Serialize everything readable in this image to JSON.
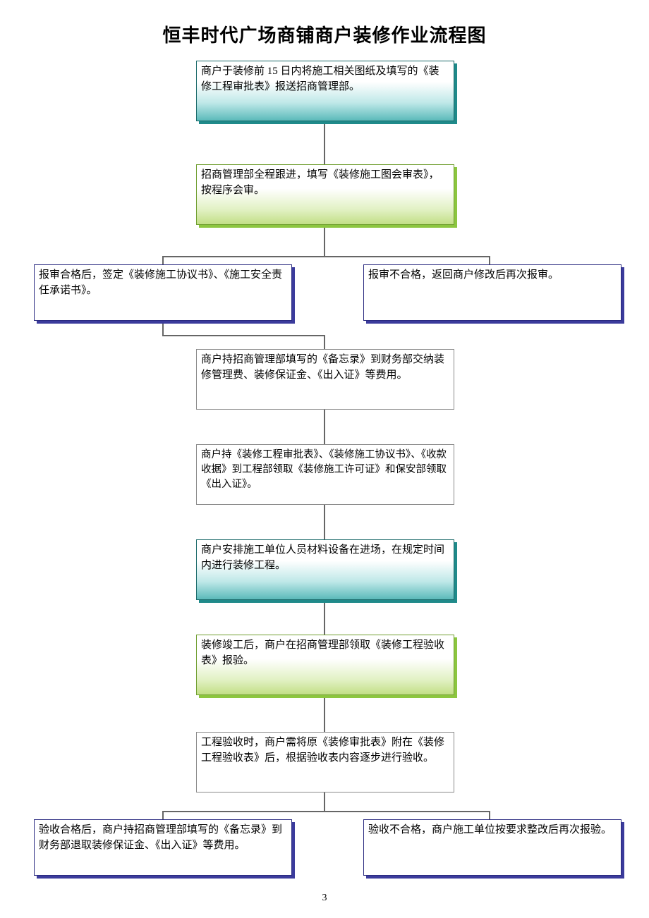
{
  "title": "恒丰时代广场商铺商户装修作业流程图",
  "page_number": "3",
  "boxes": {
    "b1": "商户于装修前 15 日内将施工相关图纸及填写的《装修工程审批表》报送招商管理部。",
    "b2": "招商管理部全程跟进，填写《装修施工图会审表》，按程序会审。",
    "b3l": "报审合格后，签定《装修施工协议书》、《施工安全责任承诺书》。",
    "b3r": "报审不合格，返回商户修改后再次报审。",
    "b4": "商户持招商管理部填写的《备忘录》到财务部交纳装修管理费、装修保证金、《出入证》等费用。",
    "b5": "商户持《装修工程审批表》、《装修施工协议书》、《收款收据》到工程部领取《装修施工许可证》和保安部领取《出入证》。",
    "b6": "商户安排施工单位人员材料设备在进场，在规定时间内进行装修工程。",
    "b7": "装修竣工后，商户在招商管理部领取《装修工程验收表》报验。",
    "b8": "工程验收时，商户需将原《装修审批表》附在《装修工程验收表》后，根据验收表内容逐步进行验收。",
    "b9l": "验收合格后，商户持招商管理部填写的《备忘录》到财务部退取装修保证金、《出入证》等费用。",
    "b9r": "验收不合格，商户施工单位按要求整改后再次报验。"
  }
}
